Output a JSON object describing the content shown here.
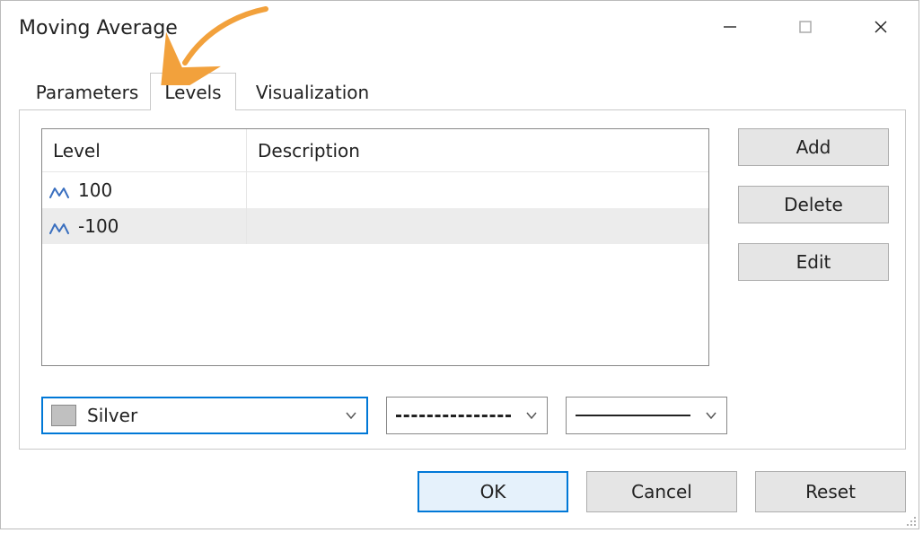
{
  "window": {
    "title": "Moving Average"
  },
  "tabs": {
    "parameters": "Parameters",
    "levels": "Levels",
    "visualization": "Visualization",
    "active": "levels"
  },
  "levels_table": {
    "headers": {
      "level": "Level",
      "description": "Description"
    },
    "rows": [
      {
        "value": "100",
        "description": "",
        "selected": false
      },
      {
        "value": "-100",
        "description": "",
        "selected": true
      }
    ]
  },
  "side_buttons": {
    "add": "Add",
    "delete": "Delete",
    "edit": "Edit"
  },
  "style": {
    "color_name": "Silver",
    "color_hex": "#c0c0c0",
    "line_style": "dashed",
    "line_width": "1"
  },
  "bottom": {
    "ok": "OK",
    "cancel": "Cancel",
    "reset": "Reset"
  }
}
